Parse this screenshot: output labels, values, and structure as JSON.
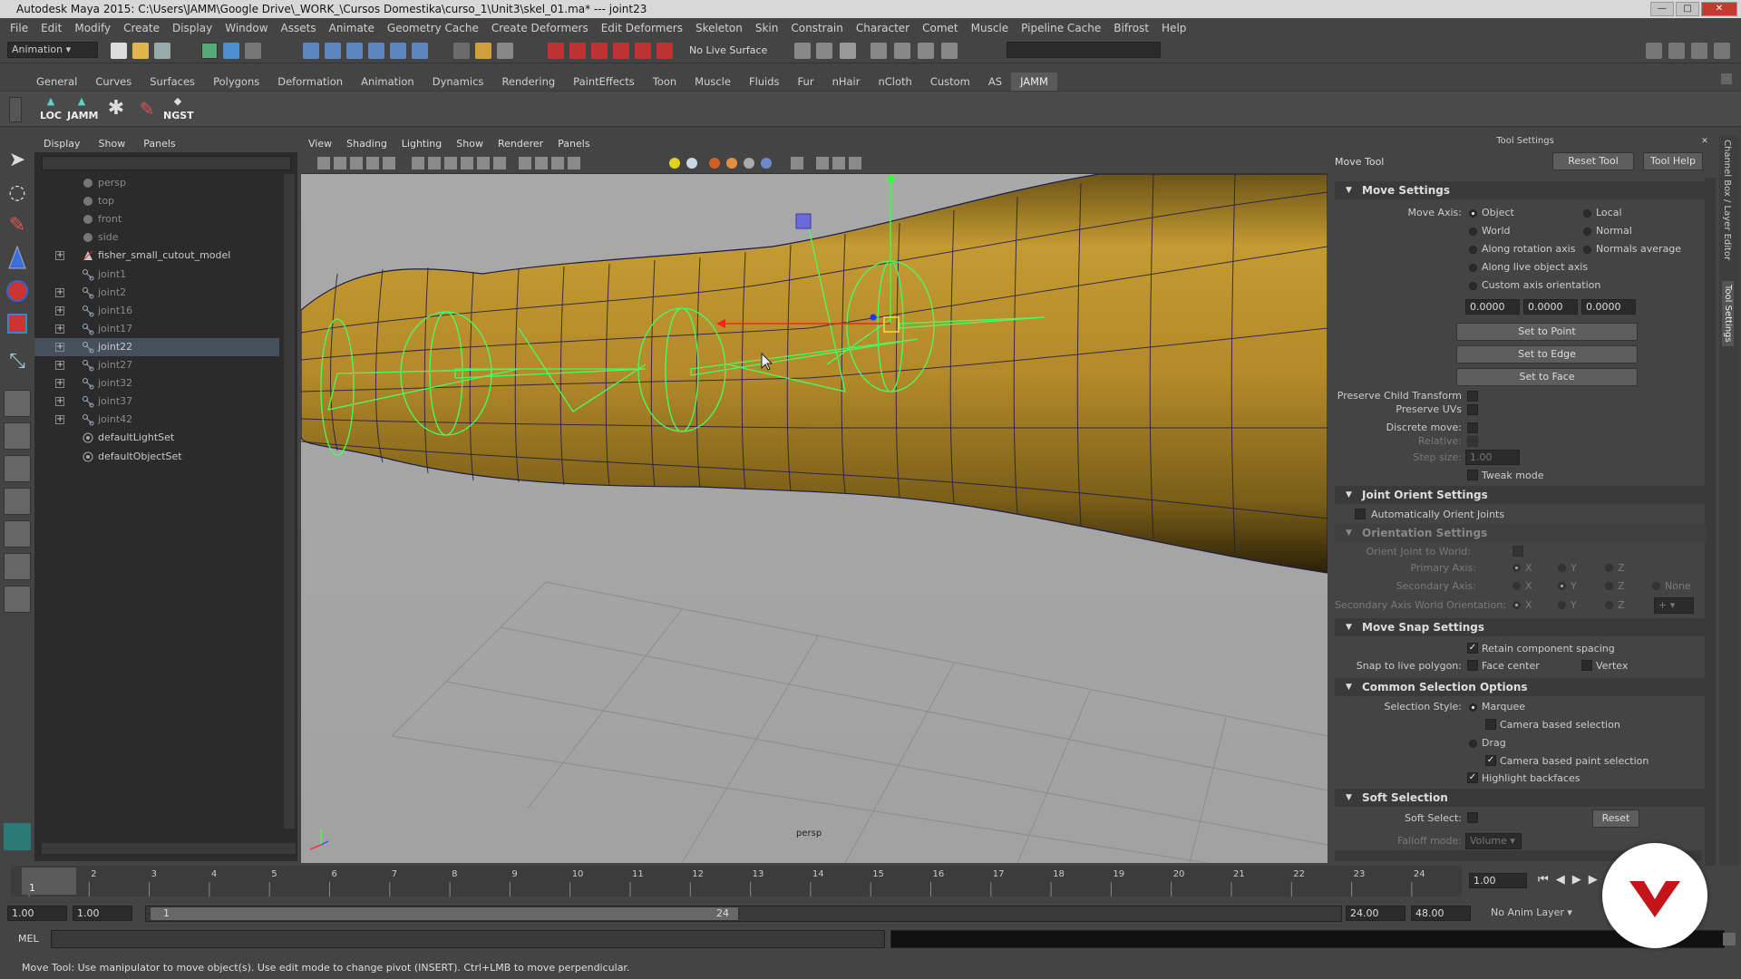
{
  "window": {
    "title": "Autodesk Maya 2015: C:\\Users\\JAMM\\Google Drive\\_WORK_\\Cursos Domestika\\curso_1\\Unit3\\skel_01.ma*   ---   joint23"
  },
  "menu": [
    "File",
    "Edit",
    "Modify",
    "Create",
    "Display",
    "Window",
    "Assets",
    "Animate",
    "Geometry Cache",
    "Create Deformers",
    "Edit Deformers",
    "Skeleton",
    "Skin",
    "Constrain",
    "Character",
    "Comet",
    "Muscle",
    "Pipeline Cache",
    "Bifrost",
    "Help"
  ],
  "status": {
    "mode": "Animation",
    "live_surface": "No Live Surface"
  },
  "shelf_tabs": [
    "General",
    "Curves",
    "Surfaces",
    "Polygons",
    "Deformation",
    "Animation",
    "Dynamics",
    "Rendering",
    "PaintEffects",
    "Toon",
    "Muscle",
    "Fluids",
    "Fur",
    "nHair",
    "nCloth",
    "Custom",
    "AS",
    "JAMM"
  ],
  "shelf_active": "JAMM",
  "shelf_buttons": [
    "LOC",
    "JAMM",
    "",
    "",
    "NGST"
  ],
  "outliner": {
    "menu": [
      "Display",
      "Show",
      "Panels"
    ],
    "items": [
      {
        "label": "persp",
        "dim": true,
        "exp": false
      },
      {
        "label": "top",
        "dim": true,
        "exp": false
      },
      {
        "label": "front",
        "dim": true,
        "exp": false
      },
      {
        "label": "side",
        "dim": true,
        "exp": false
      },
      {
        "label": "fisher_small_cutout_model",
        "dim": false,
        "exp": true
      },
      {
        "label": "joint1",
        "dim": true,
        "exp": false
      },
      {
        "label": "joint2",
        "dim": true,
        "exp": true
      },
      {
        "label": "joint16",
        "dim": true,
        "exp": true
      },
      {
        "label": "joint17",
        "dim": true,
        "exp": true
      },
      {
        "label": "joint22",
        "dim": false,
        "exp": true,
        "selected": true
      },
      {
        "label": "joint27",
        "dim": true,
        "exp": true
      },
      {
        "label": "joint32",
        "dim": true,
        "exp": true
      },
      {
        "label": "joint37",
        "dim": true,
        "exp": true
      },
      {
        "label": "joint42",
        "dim": true,
        "exp": true
      },
      {
        "label": "defaultLightSet",
        "dim": false,
        "exp": false
      },
      {
        "label": "defaultObjectSet",
        "dim": false,
        "exp": false
      }
    ]
  },
  "viewport": {
    "menu": [
      "View",
      "Shading",
      "Lighting",
      "Show",
      "Renderer",
      "Panels"
    ],
    "camera": "persp"
  },
  "tool_settings": {
    "panel_title": "Tool Settings",
    "tool_name": "Move Tool",
    "reset_tool": "Reset Tool",
    "tool_help": "Tool Help",
    "move_settings": {
      "header": "Move Settings",
      "move_axis_label": "Move Axis:",
      "axis_options": [
        "Object",
        "Local",
        "World",
        "Normal",
        "Along rotation axis",
        "Normals average",
        "Along live object axis",
        "Custom axis orientation"
      ],
      "values": [
        "0.0000",
        "0.0000",
        "0.0000"
      ],
      "set_to_point": "Set to Point",
      "set_to_edge": "Set to Edge",
      "set_to_face": "Set to Face",
      "preserve_child": "Preserve Child Transform",
      "preserve_uvs": "Preserve UVs",
      "discrete_move": "Discrete move:",
      "relative": "Relative:",
      "step_size": "Step size:",
      "step_value": "1.00",
      "tweak_mode": "Tweak mode"
    },
    "joint_orient": {
      "header": "Joint Orient Settings",
      "auto_orient": "Automatically Orient Joints",
      "orientation_header": "Orientation Settings",
      "orient_to_world": "Orient Joint to World:",
      "primary_axis": "Primary Axis:",
      "secondary_axis": "Secondary Axis:",
      "secondary_world": "Secondary Axis World Orientation:",
      "x": "X",
      "y": "Y",
      "z": "Z",
      "none": "None",
      "plus": "+"
    },
    "snap": {
      "header": "Move Snap Settings",
      "retain": "Retain component spacing",
      "snap_live": "Snap to live polygon:",
      "face_center": "Face center",
      "vertex": "Vertex"
    },
    "selection": {
      "header": "Common Selection Options",
      "style_label": "Selection Style:",
      "marquee": "Marquee",
      "camera_based": "Camera based selection",
      "drag": "Drag",
      "camera_paint": "Camera based paint selection",
      "highlight": "Highlight backfaces"
    },
    "soft": {
      "header": "Soft Selection",
      "soft_select": "Soft Select:",
      "reset": "Reset",
      "falloff_mode": "Falloff mode:",
      "falloff_value": "Volume"
    }
  },
  "timeline": {
    "ticks": [
      "1",
      "2",
      "3",
      "4",
      "5",
      "6",
      "7",
      "8",
      "9",
      "10",
      "11",
      "12",
      "13",
      "14",
      "15",
      "16",
      "17",
      "18",
      "19",
      "20",
      "21",
      "22",
      "23",
      "24"
    ],
    "current": "1.00",
    "current_frame": "1"
  },
  "range": {
    "start": "1.00",
    "start2": "1.00",
    "range_start": "1",
    "range_end": "24",
    "end": "24.00",
    "end2": "48.00",
    "anim_layer": "No Anim Layer"
  },
  "cmd": {
    "lang": "MEL"
  },
  "help": "Move Tool: Use manipulator to move object(s). Use edit mode to change pivot (INSERT).  Ctrl+LMB to move perpendicular.",
  "side_tabs": [
    "Channel Box / Layer Editor",
    "Tool Settings"
  ],
  "colors": {
    "mesh": "#b08a2c",
    "joints": "#44ff66",
    "selected_row": "#46505c",
    "logo": "#c4141a"
  }
}
